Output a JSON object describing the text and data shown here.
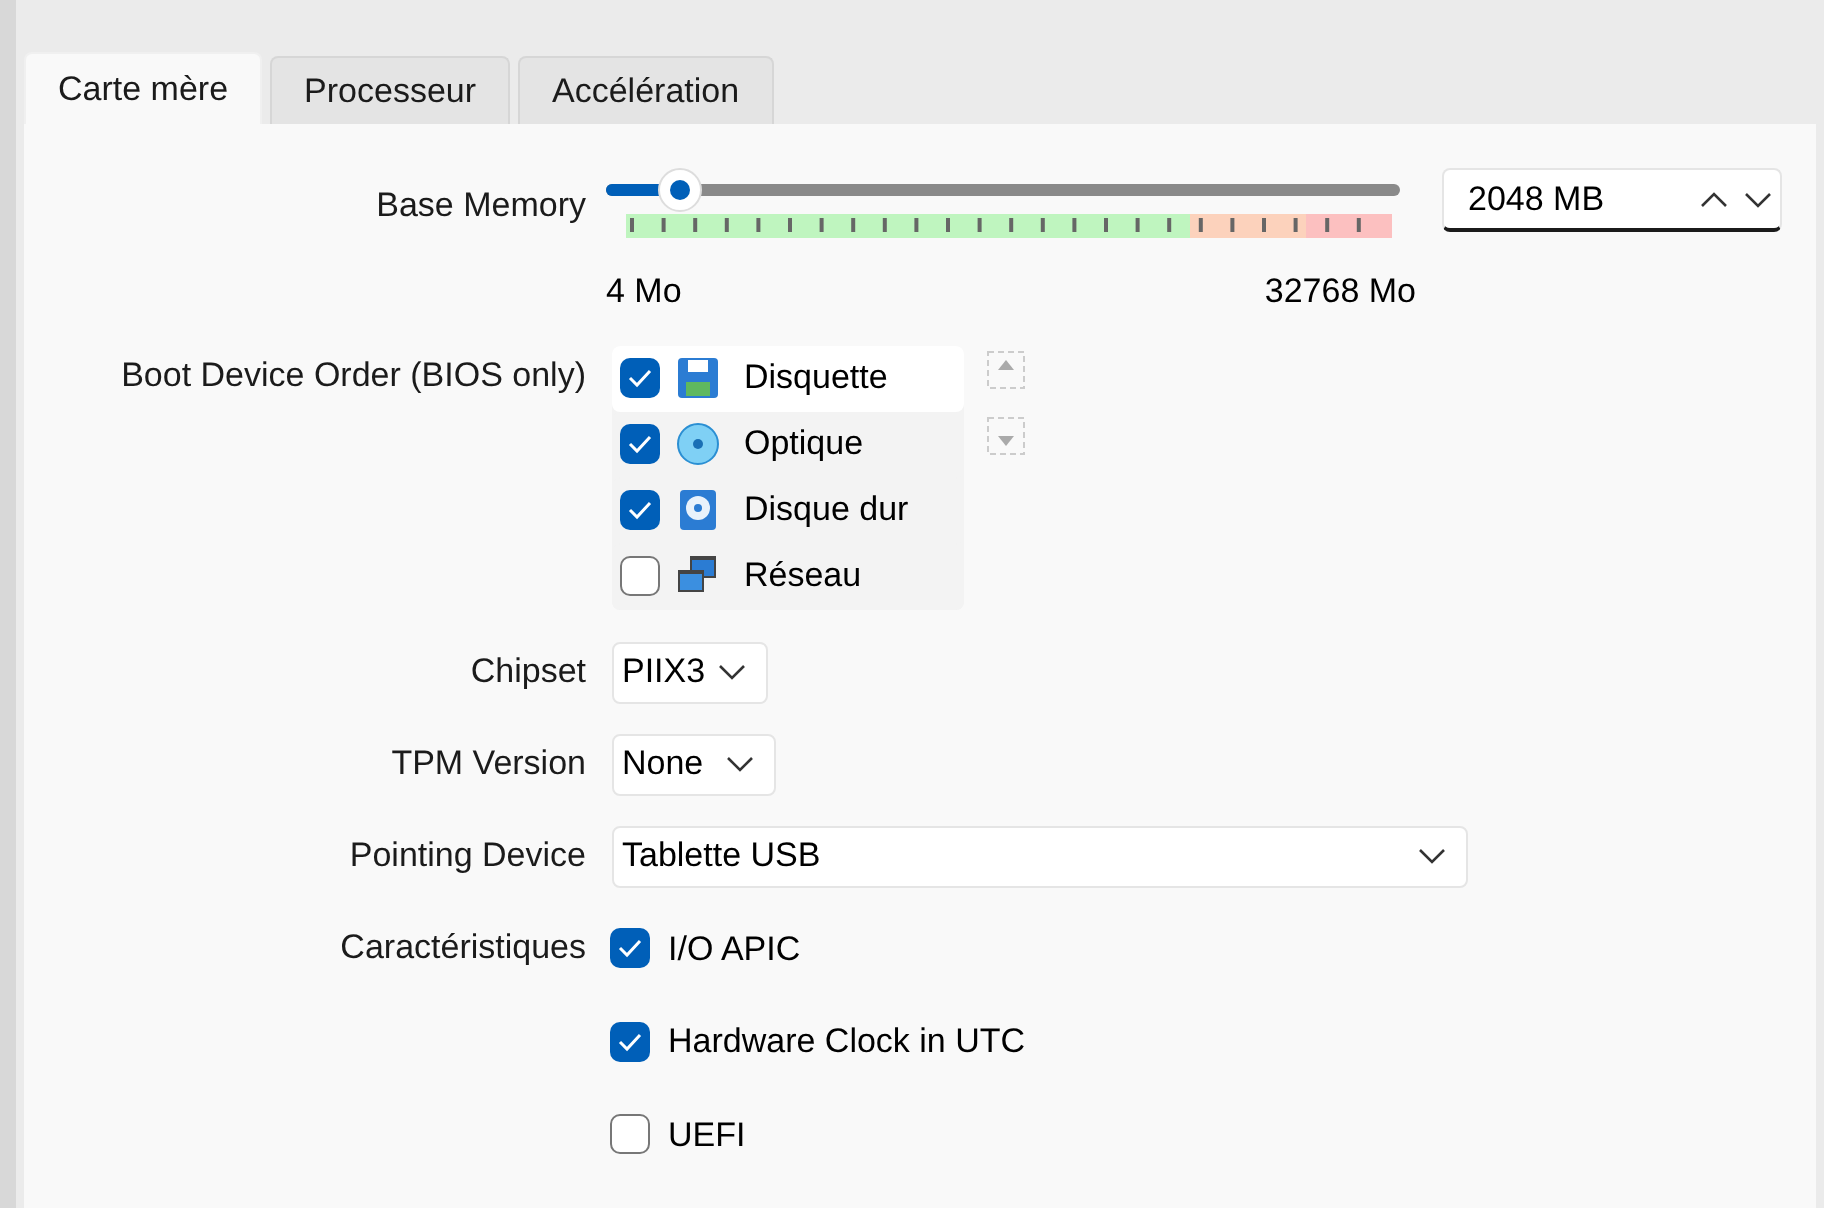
{
  "tabs": [
    {
      "label": "Carte mère",
      "selected": true
    },
    {
      "label": "Processeur",
      "selected": false
    },
    {
      "label": "Accélération",
      "selected": false
    }
  ],
  "base_memory": {
    "label": "Base Memory",
    "level": 0.094,
    "min_label": "4 Mo",
    "max_label": "32768 Mo",
    "value": "2048 MB"
  },
  "boot_order": {
    "label": "Boot Device Order (BIOS only)",
    "items": [
      {
        "kind": "floppy",
        "label": "Disquette",
        "checked": true,
        "selected": true
      },
      {
        "kind": "optical",
        "label": "Optique",
        "checked": true,
        "selected": false
      },
      {
        "kind": "harddisk",
        "label": "Disque dur",
        "checked": true,
        "selected": false
      },
      {
        "kind": "network",
        "label": "Réseau",
        "checked": false,
        "selected": false
      }
    ]
  },
  "chipset": {
    "label": "Chipset",
    "value": "PIIX3"
  },
  "tpm": {
    "label": "TPM Version",
    "value": "None"
  },
  "pointing": {
    "label": "Pointing Device",
    "value": "Tablette USB"
  },
  "features": {
    "label": "Caractéristiques",
    "items": [
      {
        "label": "I/O APIC",
        "checked": true
      },
      {
        "label": "Hardware Clock in UTC",
        "checked": true
      },
      {
        "label": "UEFI",
        "checked": false
      }
    ]
  }
}
